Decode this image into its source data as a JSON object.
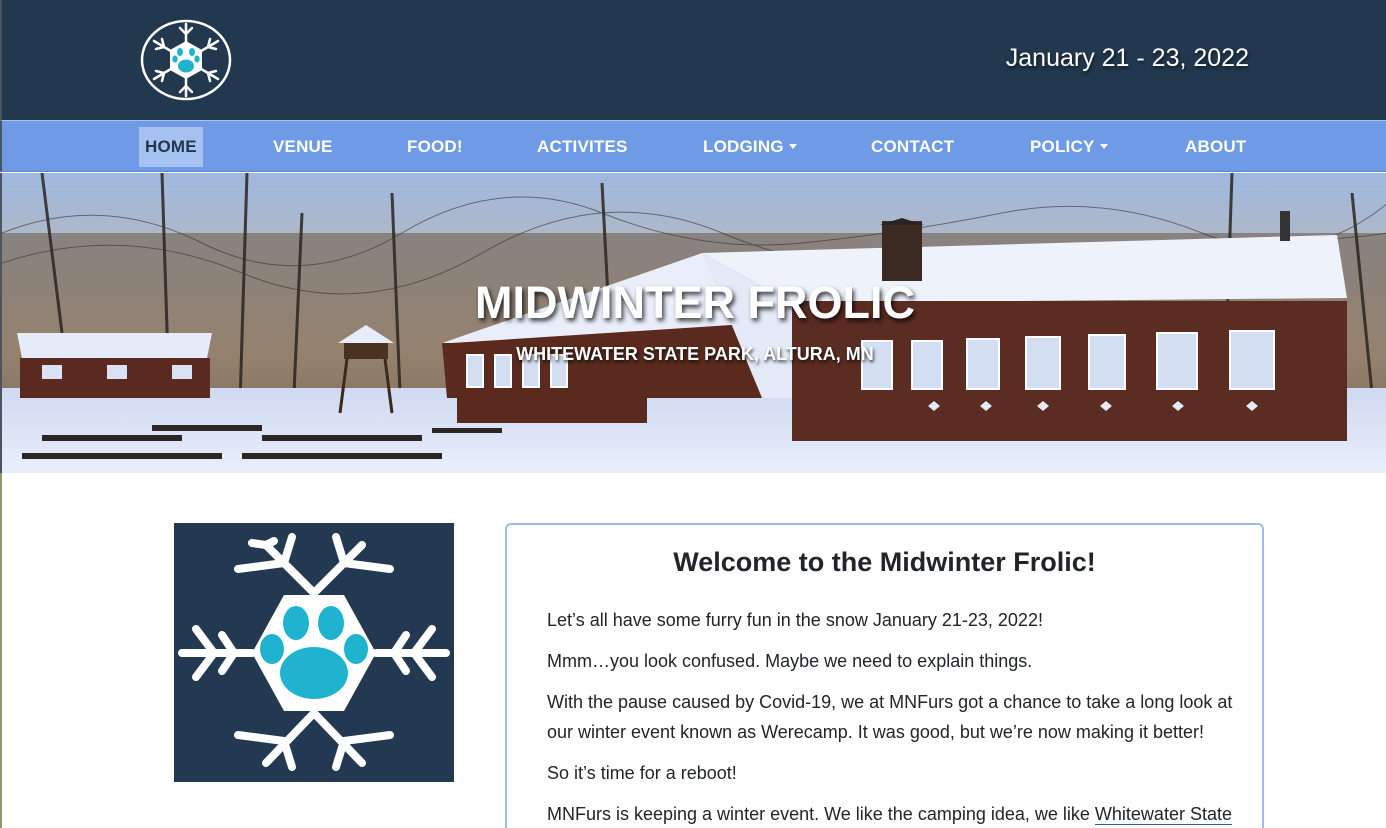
{
  "header": {
    "logo_icon": "snowflake-paw-icon",
    "date": "January 21 - 23, 2022"
  },
  "nav": {
    "items": [
      {
        "label": "HOME",
        "active": true
      },
      {
        "label": "VENUE"
      },
      {
        "label": "FOOD!"
      },
      {
        "label": "ACTIVITES"
      },
      {
        "label": "LODGING",
        "dropdown": true
      },
      {
        "label": "CONTACT"
      },
      {
        "label": "POLICY",
        "dropdown": true
      },
      {
        "label": "ABOUT"
      }
    ]
  },
  "hero": {
    "title": "MIDWINTER FROLIC",
    "subtitle": "WHITEWATER STATE PARK, ALTURA, MN"
  },
  "welcome": {
    "heading": "Welcome to the Midwinter Frolic!",
    "p1": "Let’s all have some furry fun in the snow January 21-23, 2022!",
    "p2": "Mmm…you look confused. Maybe we need to explain things.",
    "p3": "With the pause caused by Covid-19, we at MNFurs got a chance to take a long look at our winter event known as Werecamp. It was good, but we’re now making it better!",
    "p4": "So it’s time for a reboot!",
    "p5_text": "MNFurs is keeping a winter event. We like the camping idea, we like ",
    "p5_link": "Whitewater State"
  },
  "colors": {
    "header_bg": "#22384f",
    "nav_bg": "#6f9ae6",
    "nav_active_bg": "#a6c2f1",
    "paw": "#1fb3cf",
    "card_border": "#9fbbe8"
  }
}
